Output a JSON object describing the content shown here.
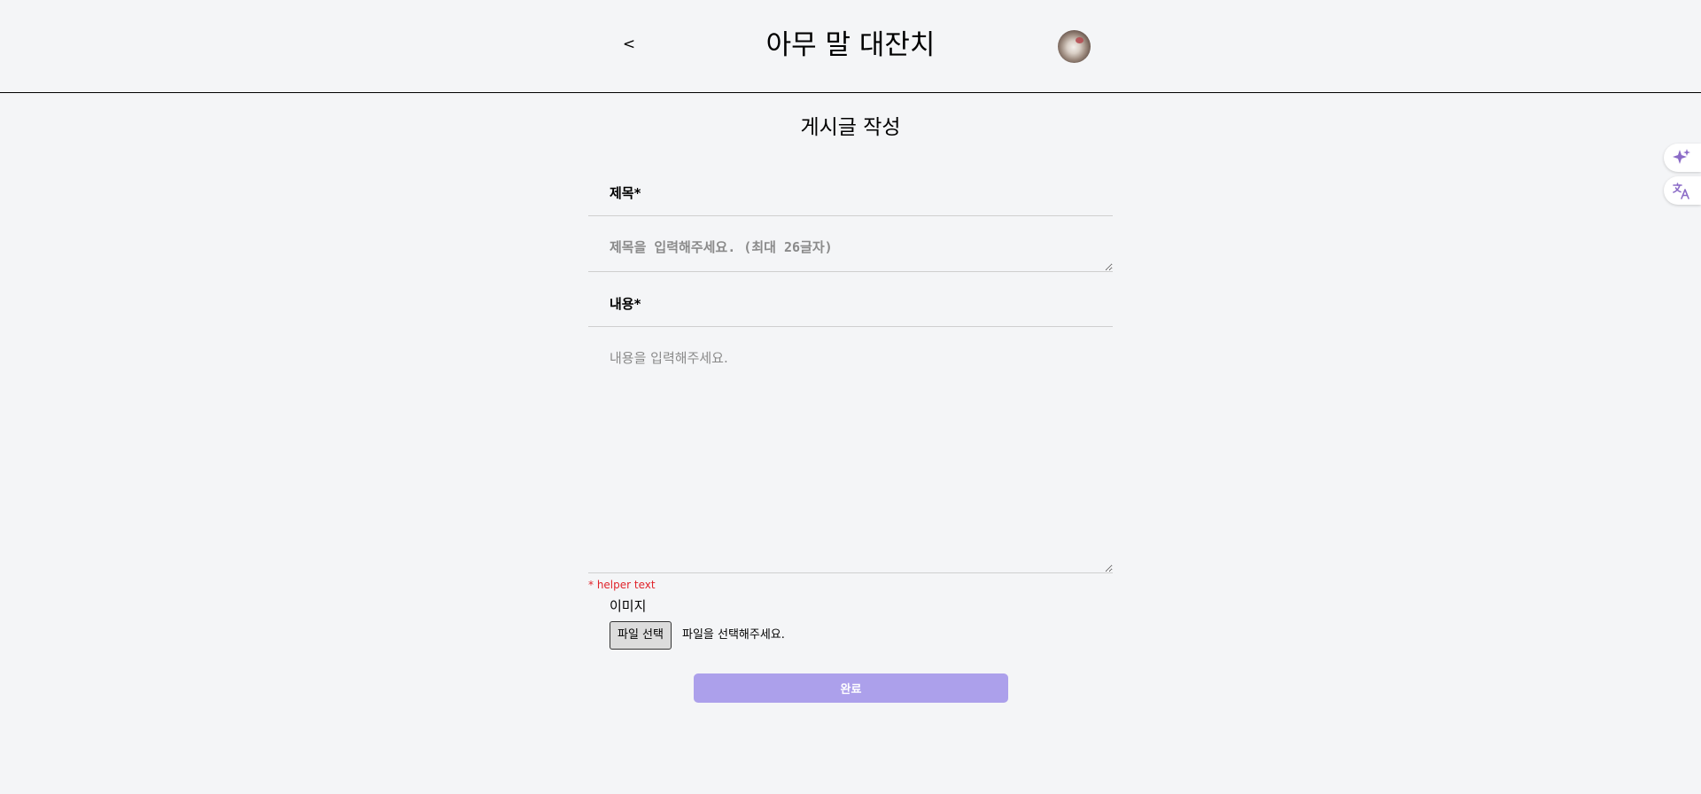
{
  "header": {
    "back_label": "<",
    "title": "아무 말 대잔치"
  },
  "page": {
    "title": "게시글 작성"
  },
  "form": {
    "title_label": "제목*",
    "title_placeholder": "제목을 입력해주세요. (최대 26글자)",
    "content_label": "내용*",
    "content_placeholder": "내용을 입력해주세요.",
    "helper_text": "* helper text",
    "image_label": "이미지",
    "file_button_label": "파일 선택",
    "file_status": "파일을 선택해주세요.",
    "submit_label": "완료"
  },
  "side_toolbar": {
    "icons": [
      "sparkle-icon",
      "translate-icon"
    ],
    "accent_color": "#8b6bc7"
  },
  "colors": {
    "background": "#f4f5f7",
    "submit_button": "#aca0eb",
    "helper_text": "#e0242b"
  }
}
